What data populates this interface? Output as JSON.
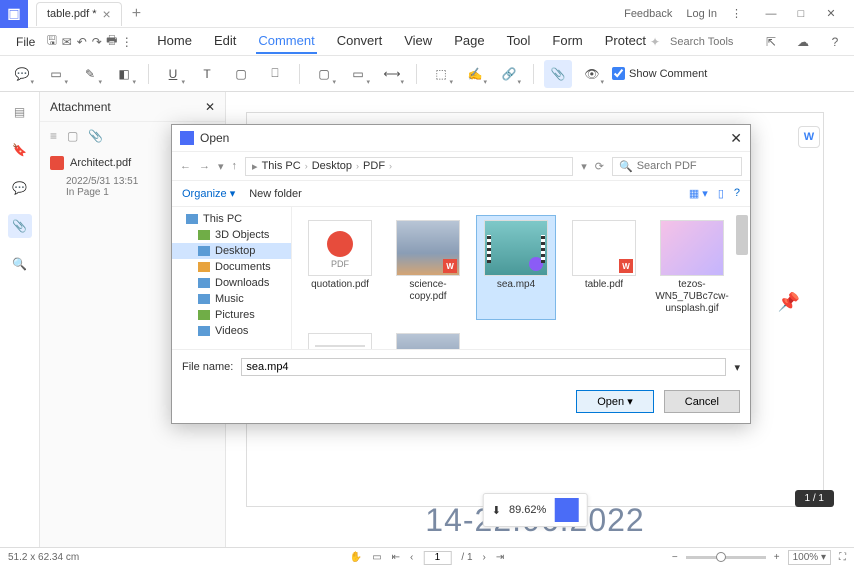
{
  "titlebar": {
    "tab_name": "table.pdf *",
    "feedback": "Feedback",
    "login": "Log In"
  },
  "menubar": {
    "file": "File",
    "items": [
      "Home",
      "Edit",
      "Comment",
      "Convert",
      "View",
      "Page",
      "Tool",
      "Form",
      "Protect"
    ],
    "active_index": 2,
    "search_placeholder": "Search Tools"
  },
  "toolbar": {
    "show_comment": "Show Comment",
    "show_comment_checked": true
  },
  "sidebar": {
    "attach_title": "Attachment",
    "item_name": "Architect.pdf",
    "item_date": "2022/5/31 13:51",
    "item_page": "In Page 1"
  },
  "canvas": {
    "date_text": "14-22.06.2022",
    "page_indicator": "1 / 1",
    "zoom_float": "89.62%"
  },
  "statusbar": {
    "dimensions": "51.2 x 62.34 cm",
    "page_current": "1",
    "page_total": "/ 1",
    "zoom_value": "100%"
  },
  "dialog": {
    "title": "Open",
    "breadcrumb": [
      "This PC",
      "Desktop",
      "PDF"
    ],
    "search_placeholder": "Search PDF",
    "organize": "Organize",
    "new_folder": "New folder",
    "tree": [
      {
        "label": "This PC",
        "level": 1,
        "icon": "ico-pc"
      },
      {
        "label": "3D Objects",
        "level": 2,
        "icon": "ico-3d"
      },
      {
        "label": "Desktop",
        "level": 2,
        "icon": "ico-desk",
        "selected": true
      },
      {
        "label": "Documents",
        "level": 2,
        "icon": "ico-doc"
      },
      {
        "label": "Downloads",
        "level": 2,
        "icon": "ico-dl"
      },
      {
        "label": "Music",
        "level": 2,
        "icon": "ico-music"
      },
      {
        "label": "Pictures",
        "level": 2,
        "icon": "ico-pic"
      },
      {
        "label": "Videos",
        "level": 2,
        "icon": "ico-vid"
      }
    ],
    "files": [
      {
        "name": "quotation.pdf",
        "type": "pdf"
      },
      {
        "name": "science-copy.pdf",
        "type": "img"
      },
      {
        "name": "sea.mp4",
        "type": "sea",
        "selected": true
      },
      {
        "name": "table.pdf",
        "type": "table"
      },
      {
        "name": "tezos-WN5_7UBc7cw-unsplash.gif",
        "type": "gif"
      },
      {
        "name": "",
        "type": "text"
      },
      {
        "name": "",
        "type": "img"
      }
    ],
    "filename_label": "File name:",
    "filename_value": "sea.mp4",
    "btn_open": "Open",
    "btn_cancel": "Cancel"
  }
}
